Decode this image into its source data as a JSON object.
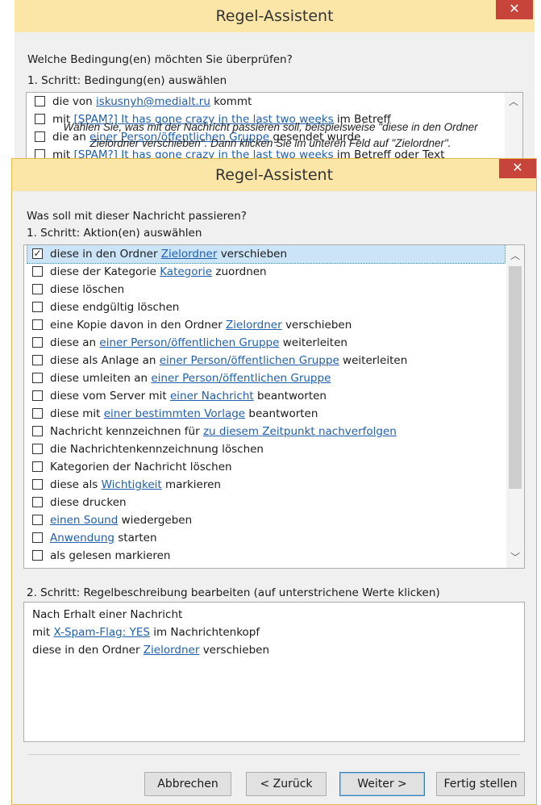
{
  "back_window": {
    "title": "Regel-Assistent",
    "close_icon": "close-icon",
    "question": "Welche Bedingung(en) möchten Sie überprüfen?",
    "step1": "1. Schritt: Bedingung(en) auswählen",
    "conditions": [
      {
        "pre": "die von ",
        "link": "iskusnyh@medialt.ru",
        "post": " kommt"
      },
      {
        "pre": "mit ",
        "link": "[SPAM?] It has gone crazy in the last two weeks",
        "post": " im Betreff"
      },
      {
        "pre": "die an ",
        "link": "einer Person/öffentlichen Gruppe",
        "post": " gesendet wurde"
      },
      {
        "pre": "mit ",
        "link": "[SPAM?] It has gone crazy in the last two weeks",
        "post": " im Betreff oder Text"
      }
    ]
  },
  "tooltip": {
    "line1": "Wählen Sie, was mit der Nachricht passieren soll, beispielsweise \"diese in den Ordner",
    "line2": "Zielordner verschieben\". Dann klicken Sie im unteren Feld auf \"Zielordner\"."
  },
  "dialog": {
    "title": "Regel-Assistent",
    "close_icon": "close-icon",
    "question": "Was soll mit dieser Nachricht passieren?",
    "step1": "1. Schritt: Aktion(en) auswählen",
    "actions": [
      {
        "checked": true,
        "pre": "diese in den Ordner ",
        "link": "Zielordner",
        "post": " verschieben"
      },
      {
        "checked": false,
        "pre": "diese der Kategorie ",
        "link": "Kategorie",
        "post": " zuordnen"
      },
      {
        "checked": false,
        "pre": "diese löschen",
        "link": "",
        "post": ""
      },
      {
        "checked": false,
        "pre": "diese endgültig löschen",
        "link": "",
        "post": ""
      },
      {
        "checked": false,
        "pre": "eine Kopie davon in den Ordner ",
        "link": "Zielordner",
        "post": " verschieben"
      },
      {
        "checked": false,
        "pre": "diese an ",
        "link": "einer Person/öffentlichen Gruppe",
        "post": " weiterleiten"
      },
      {
        "checked": false,
        "pre": "diese als Anlage an ",
        "link": "einer Person/öffentlichen Gruppe",
        "post": " weiterleiten"
      },
      {
        "checked": false,
        "pre": "diese umleiten an ",
        "link": "einer Person/öffentlichen Gruppe",
        "post": ""
      },
      {
        "checked": false,
        "pre": "diese vom Server mit ",
        "link": "einer Nachricht",
        "post": " beantworten"
      },
      {
        "checked": false,
        "pre": "diese mit ",
        "link": "einer bestimmten Vorlage",
        "post": " beantworten"
      },
      {
        "checked": false,
        "pre": "Nachricht kennzeichnen für ",
        "link": "zu diesem Zeitpunkt nachverfolgen",
        "post": ""
      },
      {
        "checked": false,
        "pre": "die Nachrichtenkennzeichnung löschen",
        "link": "",
        "post": ""
      },
      {
        "checked": false,
        "pre": "Kategorien der Nachricht löschen",
        "link": "",
        "post": ""
      },
      {
        "checked": false,
        "pre": "diese als ",
        "link": "Wichtigkeit",
        "post": " markieren"
      },
      {
        "checked": false,
        "pre": "diese drucken",
        "link": "",
        "post": ""
      },
      {
        "checked": false,
        "pre": "",
        "link": "einen Sound",
        "post": " wiedergeben"
      },
      {
        "checked": false,
        "pre": "",
        "link": "Anwendung",
        "post": " starten"
      },
      {
        "checked": false,
        "pre": "als gelesen markieren",
        "link": "",
        "post": ""
      }
    ],
    "step2": "2. Schritt: Regelbeschreibung bearbeiten (auf unterstrichene Werte klicken)",
    "description": [
      {
        "pre": "Nach Erhalt einer Nachricht",
        "link": "",
        "post": ""
      },
      {
        "pre": "mit ",
        "link": "X-Spam-Flag: YES",
        "post": " im Nachrichtenkopf"
      },
      {
        "pre": "diese in den Ordner ",
        "link": "Zielordner",
        "post": " verschieben"
      }
    ],
    "buttons": {
      "cancel": "Abbrechen",
      "back": "< Zurück",
      "next": "Weiter >",
      "finish": "Fertig stellen"
    },
    "checkmark": "✓",
    "scroll_up_icon": "chevron-up-icon",
    "scroll_down_icon": "chevron-down-icon"
  }
}
